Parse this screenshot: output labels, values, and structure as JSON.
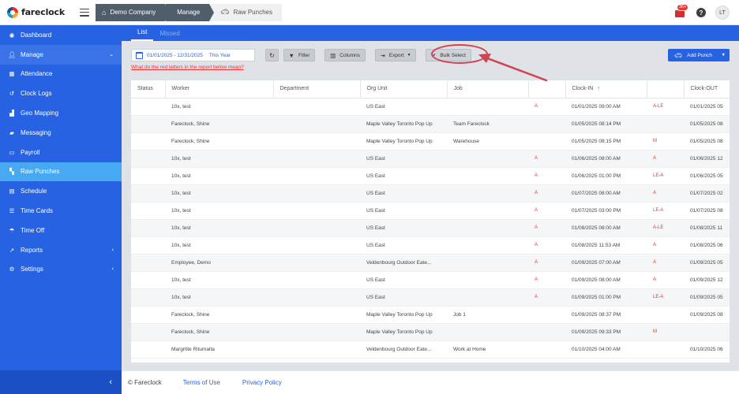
{
  "app": {
    "name": "fareclock"
  },
  "breadcrumbs": [
    {
      "label": "Demo Company",
      "icon": "home-icon"
    },
    {
      "label": "Manage"
    },
    {
      "label": "Raw Punches",
      "icon": "car-icon"
    }
  ],
  "header": {
    "notification_count": "36+",
    "help": "?",
    "avatar_initials": "LT"
  },
  "sidebar": {
    "items": [
      {
        "label": "Dashboard",
        "icon": "dashboard-icon"
      },
      {
        "label": "Manage",
        "icon": "user-icon"
      },
      {
        "label": "Attendance",
        "icon": "attendance-icon"
      },
      {
        "label": "Clock Logs",
        "icon": "history-icon"
      },
      {
        "label": "Geo Mapping",
        "icon": "map-icon"
      },
      {
        "label": "Messaging",
        "icon": "chat-icon"
      },
      {
        "label": "Payroll",
        "icon": "money-icon"
      },
      {
        "label": "Raw Punches",
        "icon": "car-icon"
      },
      {
        "label": "Schedule",
        "icon": "calendar-icon"
      },
      {
        "label": "Time Cards",
        "icon": "list-icon"
      },
      {
        "label": "Time Off",
        "icon": "umbrella-icon"
      },
      {
        "label": "Reports",
        "icon": "chart-icon"
      },
      {
        "label": "Settings",
        "icon": "gear-icon"
      }
    ],
    "collapse_icon": "‹"
  },
  "tabs": [
    {
      "label": "List"
    },
    {
      "label": "Missed"
    }
  ],
  "toolbar": {
    "date_range": "01/01/2025 - 12/31/2025",
    "date_preset": "This Year",
    "red_letters_link": "What do the red letters in the report below mean?",
    "filter_label": "Filter",
    "columns_label": "Columns",
    "export_label": "Export",
    "bulk_select_label": "Bulk Select",
    "add_punch_label": "Add Punch"
  },
  "table": {
    "columns": [
      "Status",
      "Worker",
      "Department",
      "Org Unit",
      "Job",
      "",
      "Clock-IN",
      "",
      "Clock-OUT"
    ],
    "rows": [
      [
        "",
        "10x, test",
        "",
        "US East",
        "",
        "A",
        "01/01/2025 09:00 AM",
        "A-LE",
        "01/01/2025 05"
      ],
      [
        "",
        "Fareclock, Shine",
        "",
        "Maple Valley Toronto Pop Up",
        "Team Fareclock",
        "",
        "01/05/2025 08:14 PM",
        "",
        "01/05/2025 08"
      ],
      [
        "",
        "Fareclock, Shine",
        "",
        "Maple Valley Toronto Pop Up",
        "Warehouse",
        "",
        "01/05/2025 08:15 PM",
        "M",
        "01/05/2025 08"
      ],
      [
        "",
        "10x, test",
        "",
        "US East",
        "",
        "A",
        "01/06/2025 08:00 AM",
        "A",
        "01/06/2025 12"
      ],
      [
        "",
        "10x, test",
        "",
        "US East",
        "",
        "A",
        "01/06/2025 01:00 PM",
        "LE-A",
        "01/06/2025 05"
      ],
      [
        "",
        "10x, test",
        "",
        "US East",
        "",
        "A",
        "01/07/2025 08:00 AM",
        "A",
        "01/07/2025 02"
      ],
      [
        "",
        "10x, test",
        "",
        "US East",
        "",
        "A",
        "01/07/2025 03:00 PM",
        "LE-A",
        "01/07/2025 08"
      ],
      [
        "",
        "10x, test",
        "",
        "US East",
        "",
        "A",
        "01/08/2025 08:00 AM",
        "A-LE",
        "01/08/2025 11"
      ],
      [
        "",
        "10x, test",
        "",
        "US East",
        "",
        "A",
        "01/08/2025 11:53 AM",
        "A",
        "01/08/2025 06"
      ],
      [
        "",
        "Employee, Demo",
        "",
        "Veldenbourg Outdoor Eate...",
        "",
        "A",
        "01/09/2025 07:00 AM",
        "A",
        "01/09/2025 05"
      ],
      [
        "",
        "10x, test",
        "",
        "US East",
        "",
        "A",
        "01/09/2025 08:00 AM",
        "A",
        "01/09/2025 12"
      ],
      [
        "",
        "10x, test",
        "",
        "US East",
        "",
        "A",
        "01/09/2025 01:00 PM",
        "LE-A",
        "01/09/2025 05"
      ],
      [
        "",
        "Fareclock, Shine",
        "",
        "Maple Valley Toronto Pop Up",
        "Job 1",
        "",
        "01/09/2025 08:37 PM",
        "",
        "01/09/2025 08"
      ],
      [
        "",
        "Fareclock, Shine",
        "",
        "Maple Valley Toronto Pop Up",
        "",
        "",
        "01/09/2025 09:33 PM",
        "M",
        ""
      ],
      [
        "",
        "Margritte Ritumalta",
        "",
        "Veldenbourg Outdoor Eate...",
        "Work at Home",
        "",
        "01/10/2025 04:00 AM",
        "",
        "01/10/2025 06"
      ]
    ]
  },
  "footer": {
    "copyright": "© Fareclock",
    "terms": "Terms of Use",
    "privacy": "Privacy Policy"
  }
}
